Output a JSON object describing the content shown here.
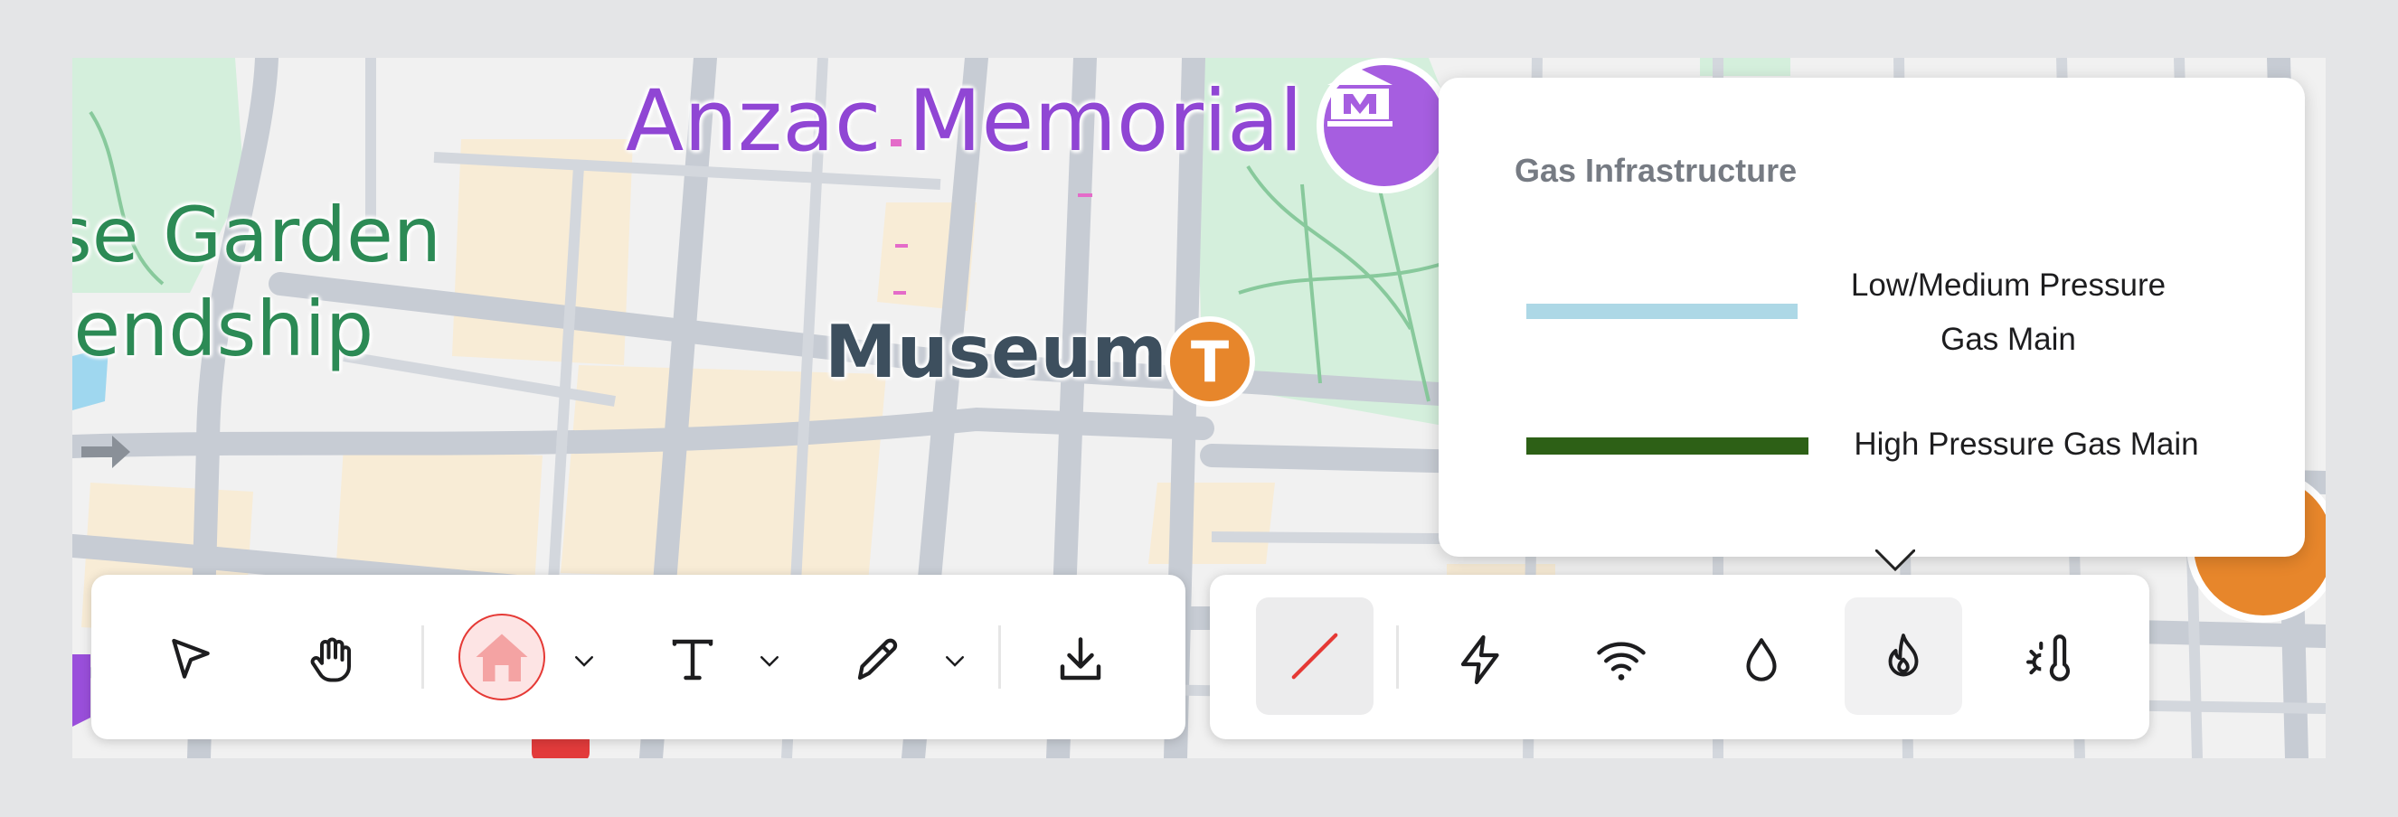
{
  "map": {
    "labels": {
      "anzac_memorial": "Anzac Memorial",
      "garden_line1": "se Garden",
      "garden_line2": "iendship",
      "museum": "Museum"
    },
    "museum_pin_letter": "T"
  },
  "legend": {
    "title": "Gas Infrastructure",
    "items": [
      {
        "label_line1": "Low/Medium Pressure",
        "label_line2": "Gas Main",
        "color": "#add8e6"
      },
      {
        "label": "High Pressure Gas Main",
        "color": "#2d6016"
      }
    ]
  },
  "toolbar_left": {
    "tools": [
      "select-tool",
      "pan-tool",
      "marker-tool",
      "text-tool",
      "pen-tool",
      "download"
    ],
    "marker_color": "#f4a3a3"
  },
  "toolbar_right": {
    "layers": [
      "line-layer",
      "electricity-layer",
      "wifi-layer",
      "water-layer",
      "gas-layer",
      "temperature-layer"
    ],
    "active": [
      "line-layer",
      "gas-layer"
    ],
    "line_color": "#e53935"
  }
}
